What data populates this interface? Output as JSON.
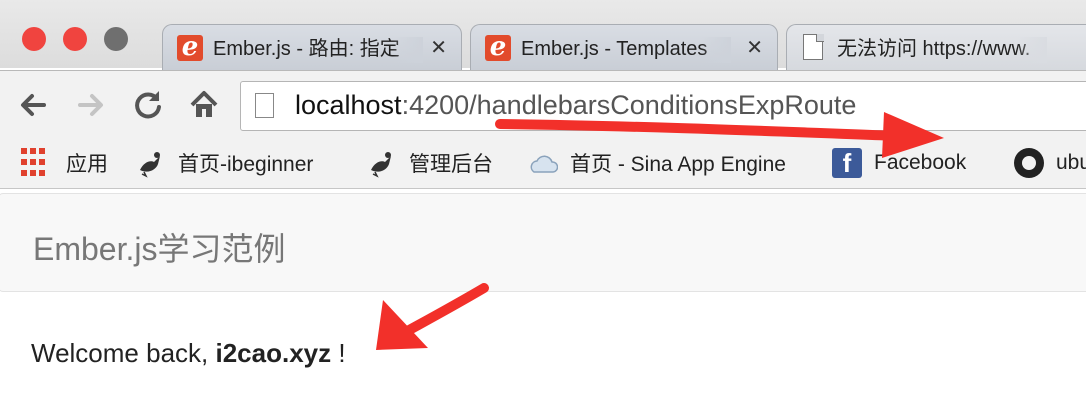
{
  "window": {
    "tabs": [
      {
        "title": "Ember.js - 路由: 指定",
        "favicon": "ember-icon",
        "close": "✕"
      },
      {
        "title": "Ember.js - Templates",
        "favicon": "ember-icon",
        "close": "✕"
      },
      {
        "title": "无法访问 https://www.",
        "favicon": "document-icon",
        "close": "✕"
      }
    ]
  },
  "toolbar": {
    "url_host": "localhost",
    "url_rest": ":4200/handlebarsConditionsExpRoute"
  },
  "bookmarks": [
    {
      "label": "应用",
      "icon": "apps-grid-icon"
    },
    {
      "label": "首页-ibeginner",
      "icon": "bird-icon"
    },
    {
      "label": "管理后台",
      "icon": "bird-icon"
    },
    {
      "label": "首页 - Sina App Engine",
      "icon": "cloud-icon"
    },
    {
      "label": "Facebook",
      "icon": "facebook-icon"
    },
    {
      "label": "ubuntu",
      "icon": "github-icon"
    }
  ],
  "page": {
    "brand": "Ember.js学习范例",
    "welcome_prefix": "Welcome back, ",
    "username": "i2cao.xyz",
    "welcome_suffix": " !"
  },
  "colors": {
    "annotation_arrow": "#f2302a",
    "ember_brand": "#e24b2c"
  }
}
